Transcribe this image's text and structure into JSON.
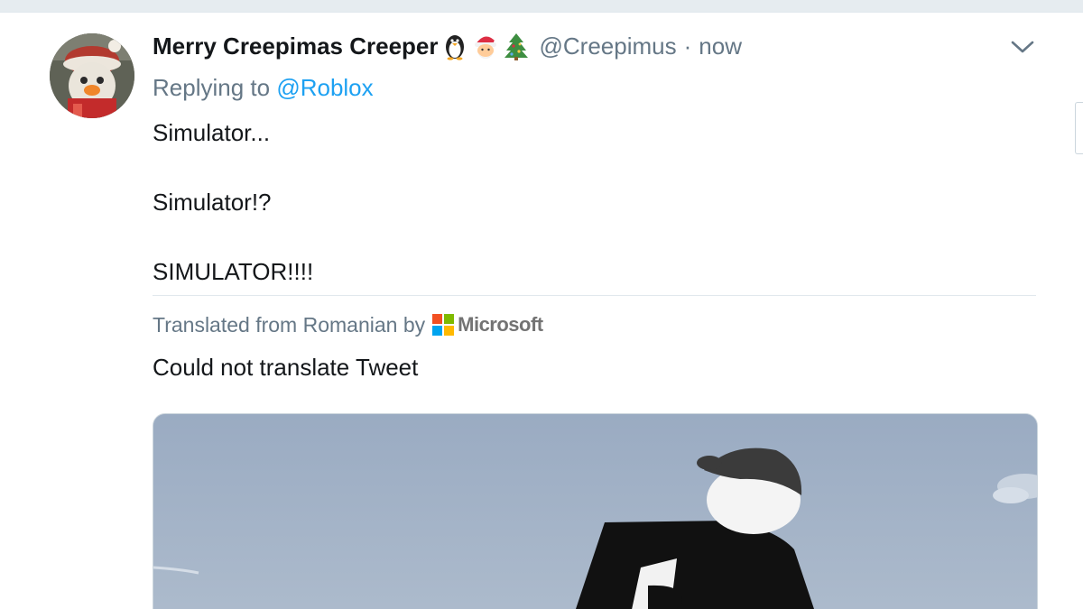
{
  "tweet": {
    "display_name": "Merry Creepimas Creeper",
    "name_emojis": [
      "penguin-emoji",
      "santa-emoji",
      "christmas-tree-emoji"
    ],
    "handle": "@Creepimus",
    "separator": "·",
    "timestamp": "now",
    "reply_prefix": "Replying to",
    "reply_mention": "@Roblox",
    "text_lines": [
      "Simulator...",
      "",
      "Simulator!?",
      "",
      "SIMULATOR!!!!"
    ],
    "translation_label": "Translated from Romanian by",
    "translator_brand": "Microsoft",
    "translation_result": "Could not translate Tweet"
  },
  "colors": {
    "text_primary": "#14171a",
    "text_secondary": "#657786",
    "link": "#1da1f2",
    "divider": "#e1e8ed",
    "microsoft_red": "#f25022",
    "microsoft_green": "#7fba00",
    "microsoft_blue": "#00a4ef",
    "microsoft_yellow": "#ffb900"
  },
  "icons": {
    "more_menu": "chevron-down-icon",
    "translator_logo": "microsoft-logo-icon"
  }
}
